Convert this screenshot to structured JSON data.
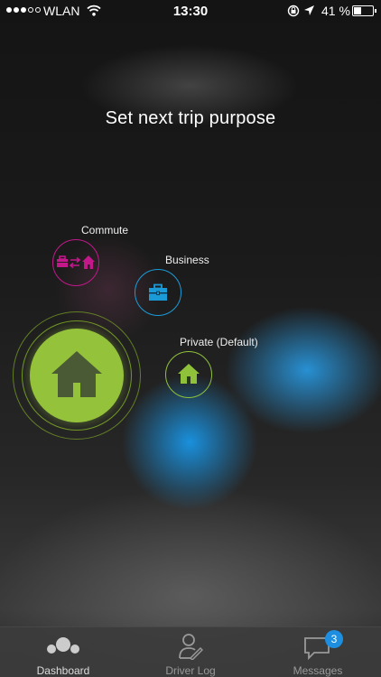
{
  "status_bar": {
    "carrier": "WLAN",
    "time": "13:30",
    "battery": "41 %",
    "battery_level": 0.41
  },
  "headline": "Set next trip purpose",
  "purposes": {
    "commute": {
      "label": "Commute",
      "color": "#c2188a"
    },
    "business": {
      "label": "Business",
      "color": "#1a9bd8"
    },
    "private": {
      "label": "Private (Default)",
      "color": "#8fc13b"
    },
    "selected": "private"
  },
  "tabs": {
    "dashboard": {
      "label": "Dashboard"
    },
    "driver_log": {
      "label": "Driver Log"
    },
    "messages": {
      "label": "Messages",
      "badge": "3"
    }
  }
}
